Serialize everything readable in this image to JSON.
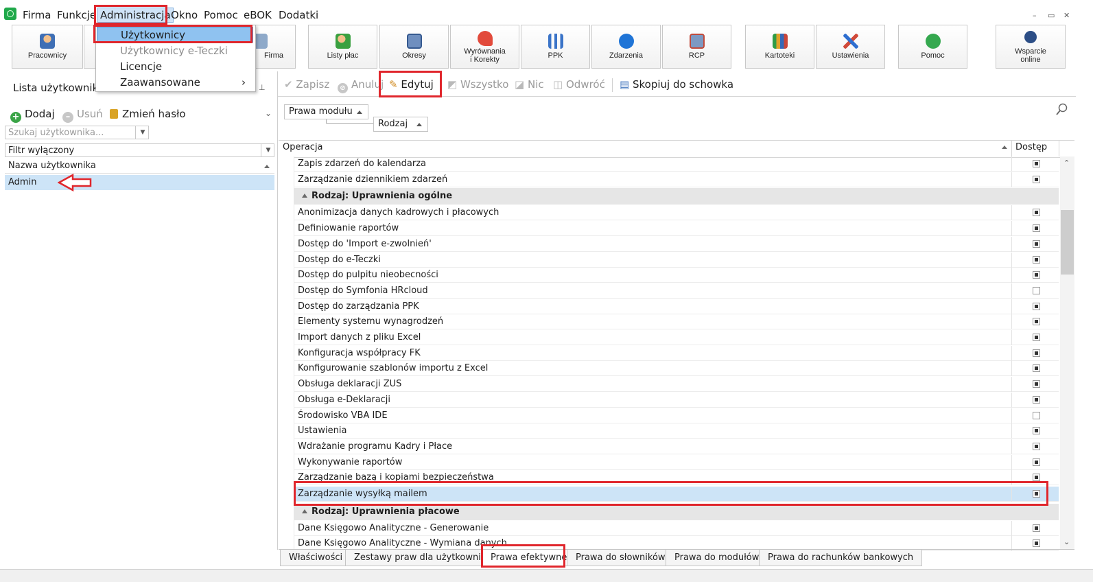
{
  "menubar": {
    "items": [
      "Firma",
      "Funkcje",
      "Administracja",
      "Okno",
      "Pomoc",
      "eBOK",
      "Dodatki"
    ]
  },
  "window_controls": {
    "minimize": "–",
    "restore": "▭",
    "close": "✕"
  },
  "toolbar": {
    "pracownicy": "Pracownicy",
    "firma": "Firma",
    "listy_plac": "Listy płac",
    "okresy": "Okresy",
    "wyrownania_line1": "Wyrównania",
    "wyrownania_line2": "i Korekty",
    "ppk": "PPK",
    "zdarzenia": "Zdarzenia",
    "rcp": "RCP",
    "kartoteki": "Kartoteki",
    "ustawienia": "Ustawienia",
    "pomoc": "Pomoc",
    "wsparcie_line1": "Wsparcie",
    "wsparcie_line2": "online"
  },
  "dropdown": {
    "items": [
      "Użytkownicy",
      "Użytkownicy e-Teczki",
      "Licencje",
      "Zaawansowane"
    ],
    "submenu_arrow": "›"
  },
  "left": {
    "title": "Lista użytkowniko",
    "pin": "⊥",
    "add": "Dodaj",
    "remove": "Usuń",
    "change_password": "Zmień hasło",
    "search_placeholder": "Szukaj użytkownika...",
    "filter": "Filtr wyłączony",
    "column": "Nazwa użytkownika",
    "users": [
      "Admin"
    ]
  },
  "right": {
    "toolbar": {
      "save": "Zapisz",
      "cancel": "Anuluj",
      "edit": "Edytuj",
      "all": "Wszystko",
      "none": "Nic",
      "invert": "Odwróć",
      "copy": "Skopiuj do schowka"
    },
    "group_module": "Prawa modułu",
    "group_kind": "Rodzaj",
    "col_operation": "Operacja",
    "col_access": "Dostęp",
    "rows_top": [
      {
        "label": "Zapis zdarzeń do kalendarza",
        "on": true
      },
      {
        "label": "Zarządzanie dziennikiem zdarzeń",
        "on": true
      }
    ],
    "group1": "Rodzaj: Uprawnienia ogólne",
    "rows_general": [
      {
        "label": "Anonimizacja danych kadrowych i płacowych",
        "on": true
      },
      {
        "label": "Definiowanie raportów",
        "on": true
      },
      {
        "label": "Dostęp do 'Import e-zwolnień'",
        "on": true
      },
      {
        "label": "Dostęp do e-Teczki",
        "on": true
      },
      {
        "label": "Dostęp do pulpitu nieobecności",
        "on": true
      },
      {
        "label": "Dostęp do Symfonia HRcloud",
        "on": false
      },
      {
        "label": "Dostęp do zarządzania PPK",
        "on": true
      },
      {
        "label": "Elementy systemu wynagrodzeń",
        "on": true
      },
      {
        "label": "Import danych z pliku Excel",
        "on": true
      },
      {
        "label": "Konfiguracja współpracy FK",
        "on": true
      },
      {
        "label": "Konfigurowanie szablonów importu z Excel",
        "on": true
      },
      {
        "label": "Obsługa deklaracji ZUS",
        "on": true
      },
      {
        "label": "Obsługa e-Deklaracji",
        "on": true
      },
      {
        "label": "Środowisko VBA IDE",
        "on": false
      },
      {
        "label": "Ustawienia",
        "on": true
      },
      {
        "label": "Wdrażanie programu Kadry i Płace",
        "on": true
      },
      {
        "label": "Wykonywanie raportów",
        "on": true
      },
      {
        "label": "Zarządzanie bazą i kopiami bezpieczeństwa",
        "on": true
      },
      {
        "label": "Zarządzanie wysyłką mailem",
        "on": true
      }
    ],
    "group2": "Rodzaj: Uprawnienia płacowe",
    "rows_payroll": [
      {
        "label": "Dane Księgowo Analityczne - Generowanie",
        "on": true
      },
      {
        "label": "Dane Księgowo Analityczne - Wymiana danych",
        "on": true
      }
    ]
  },
  "tabs": [
    "Właściwości",
    "Zestawy praw dla użytkownika",
    "Prawa efektywne",
    "Prawa do słowników",
    "Prawa do modułów",
    "Prawa do rachunków bankowych"
  ]
}
